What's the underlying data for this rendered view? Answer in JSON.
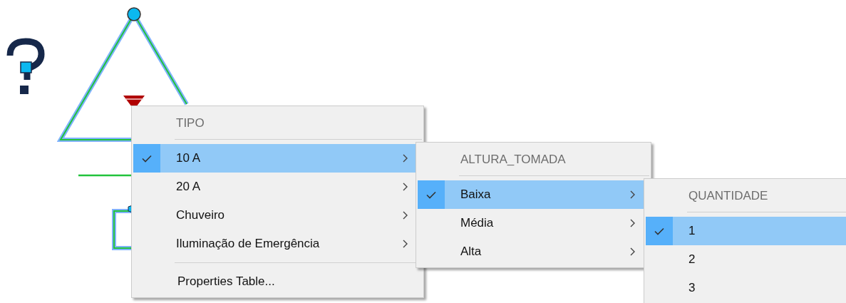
{
  "menus": [
    {
      "header": "TIPO",
      "items": [
        {
          "label": "10 A",
          "checked": true,
          "selected": true,
          "submenu": true
        },
        {
          "label": "20 A",
          "checked": false,
          "selected": false,
          "submenu": true
        },
        {
          "label": "Chuveiro",
          "checked": false,
          "selected": false,
          "submenu": true
        },
        {
          "label": "Iluminação de Emergência",
          "checked": false,
          "selected": false,
          "submenu": true
        }
      ],
      "footer": "Properties Table..."
    },
    {
      "header": "ALTURA_TOMADA",
      "items": [
        {
          "label": "Baixa",
          "checked": true,
          "selected": true,
          "submenu": true
        },
        {
          "label": "Média",
          "checked": false,
          "selected": false,
          "submenu": true
        },
        {
          "label": "Alta",
          "checked": false,
          "selected": false,
          "submenu": true
        }
      ]
    },
    {
      "header": "QUANTIDADE",
      "items": [
        {
          "label": "1",
          "checked": true,
          "selected": true,
          "submenu": false
        },
        {
          "label": "2",
          "checked": false,
          "selected": false,
          "submenu": false
        },
        {
          "label": "3",
          "checked": false,
          "selected": false,
          "submenu": false
        }
      ]
    }
  ]
}
